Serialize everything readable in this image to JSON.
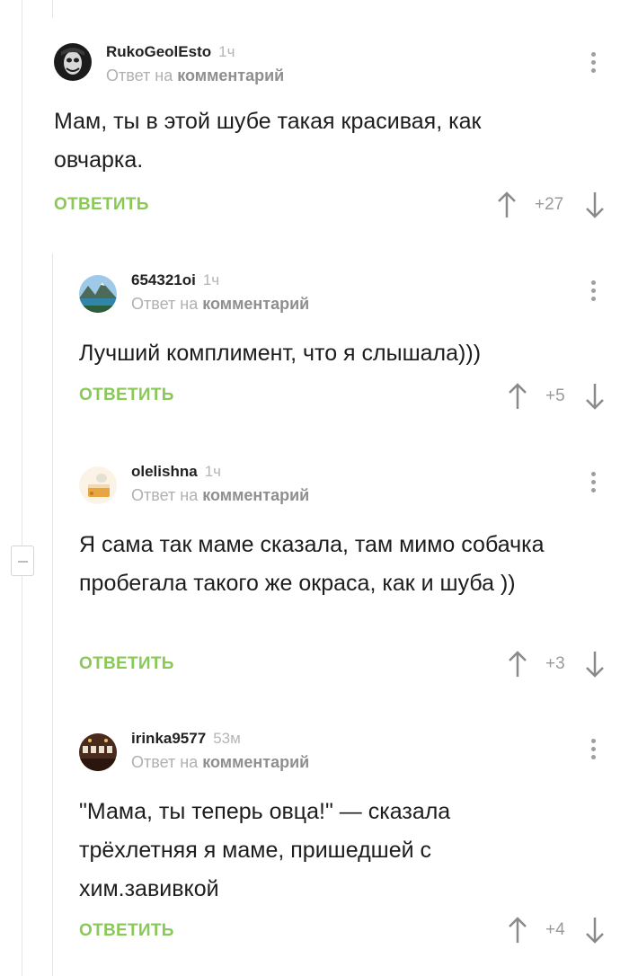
{
  "ui": {
    "reply_to_prefix": "Ответ на",
    "reply_to_target": "комментарий",
    "reply_label": "ОТВЕТИТЬ"
  },
  "comments": [
    {
      "author": "RukoGeolEsto",
      "time": "1ч",
      "text": "Мам, ты в этой шубе такая красивая, как овчарка.",
      "rating": "+27",
      "avatar_icon": "joker-avatar-icon"
    },
    {
      "author": "654321oi",
      "time": "1ч",
      "text": "Лучший комплимент, что я слышала)))",
      "rating": "+5",
      "avatar_icon": "mountain-lake-avatar-icon"
    },
    {
      "author": "olelishna",
      "time": "1ч",
      "text": "Я сама так маме сказала, там мимо собачка пробегала такого же окраса, как и шуба ))",
      "rating": "+3",
      "avatar_icon": "cake-avatar-icon"
    },
    {
      "author": "irinka9577",
      "time": "53м",
      "text": "\"Мама, ты теперь овца!\" — сказала трёхлетняя я маме, пришедшей с хим.завивкой",
      "rating": "+4",
      "avatar_icon": "room-avatar-icon"
    }
  ],
  "colors": {
    "accent_green": "#8ac858",
    "muted_text": "#b0b0b0",
    "thread_line": "#e6e6e6"
  }
}
